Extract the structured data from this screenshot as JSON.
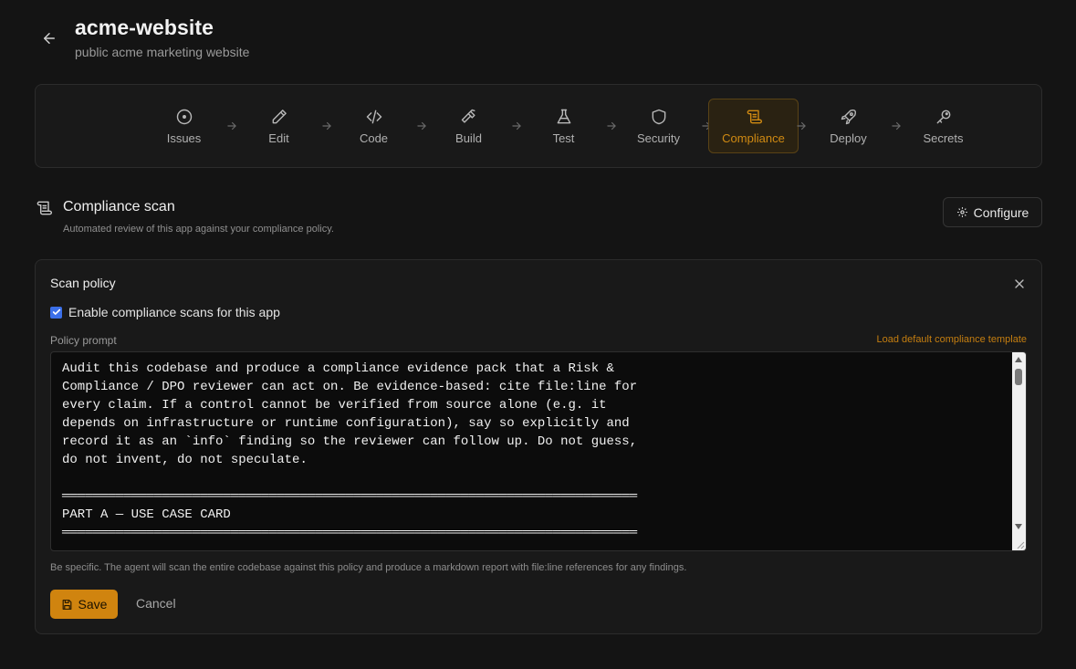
{
  "header": {
    "title": "acme-website",
    "subtitle": "public acme marketing website"
  },
  "stepper": {
    "steps": [
      {
        "label": "Issues",
        "icon": "circle-dot-icon"
      },
      {
        "label": "Edit",
        "icon": "pencil-icon"
      },
      {
        "label": "Code",
        "icon": "code-icon"
      },
      {
        "label": "Build",
        "icon": "hammer-icon"
      },
      {
        "label": "Test",
        "icon": "flask-icon"
      },
      {
        "label": "Security",
        "icon": "shield-icon"
      },
      {
        "label": "Compliance",
        "icon": "scroll-icon"
      },
      {
        "label": "Deploy",
        "icon": "rocket-icon"
      },
      {
        "label": "Secrets",
        "icon": "key-icon"
      }
    ],
    "active": "Compliance",
    "accent_color": "#d08a12"
  },
  "section": {
    "title": "Compliance scan",
    "subtitle": "Automated review of this app against your compliance policy.",
    "configure_label": "Configure"
  },
  "panel": {
    "title": "Scan policy",
    "enable_label": "Enable compliance scans for this app",
    "enable_checked": true,
    "prompt_label": "Policy prompt",
    "load_template_label": "Load default compliance template",
    "prompt_text": "Audit this codebase and produce a compliance evidence pack that a Risk &\nCompliance / DPO reviewer can act on. Be evidence-based: cite file:line for\nevery claim. If a control cannot be verified from source alone (e.g. it\ndepends on infrastructure or runtime configuration), say so explicitly and\nrecord it as an `info` finding so the reviewer can follow up. Do not guess,\ndo not invent, do not speculate.\n\n═══════════════════════════════════════════════════════════════════════════\nPART A — USE CASE CARD\n═══════════════════════════════════════════════════════════════════════════",
    "hint": "Be specific. The agent will scan the entire codebase against this policy and produce a markdown report with file:line references for any findings.",
    "save_label": "Save",
    "cancel_label": "Cancel"
  }
}
